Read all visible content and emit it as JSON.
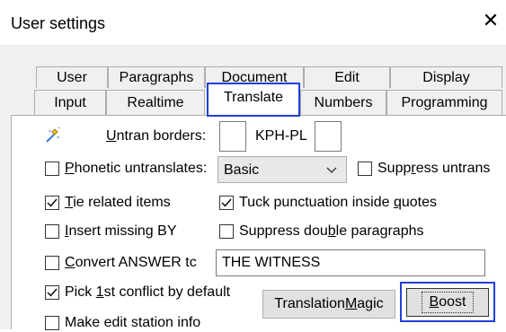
{
  "window": {
    "title": "User settings",
    "close_symbol": "✕"
  },
  "tabs": {
    "row1": [
      "User",
      "Paragraphs",
      "Document",
      "Edit",
      "Display"
    ],
    "row2": [
      "Input",
      "Realtime",
      "Translate",
      "Numbers",
      "Programming"
    ],
    "selected": "Translate"
  },
  "translate": {
    "untran_borders": {
      "label": "Untran borders:",
      "value_left": "",
      "value_mid": "KPH-PL",
      "value_right": ""
    },
    "phonetic": {
      "label": "Phonetic untranslates:",
      "checked": false,
      "select_value": "Basic"
    },
    "suppress_untrans": {
      "label": "Suppress untrans",
      "checked": false
    },
    "tie_related": {
      "label": "Tie related items",
      "checked": true
    },
    "tuck_punct": {
      "label": "Tuck punctuation inside quotes",
      "checked": true
    },
    "insert_missing_by": {
      "label": "Insert missing BY",
      "checked": false
    },
    "suppress_double": {
      "label": "Suppress double paragraphs",
      "checked": false
    },
    "convert_answer": {
      "label": "Convert ANSWER tc",
      "checked": false,
      "value": "THE WITNESS"
    },
    "pick_first": {
      "label": "Pick 1st conflict by default",
      "checked": true
    },
    "make_edit_station": {
      "label": "Make edit station info",
      "checked": false
    },
    "translation_magic_button": "Translation Magic",
    "boost_button": "Boost"
  },
  "colors": {
    "highlight": "#1f40d8",
    "panel": "#ffffff",
    "dialog": "#f0f0f0"
  }
}
